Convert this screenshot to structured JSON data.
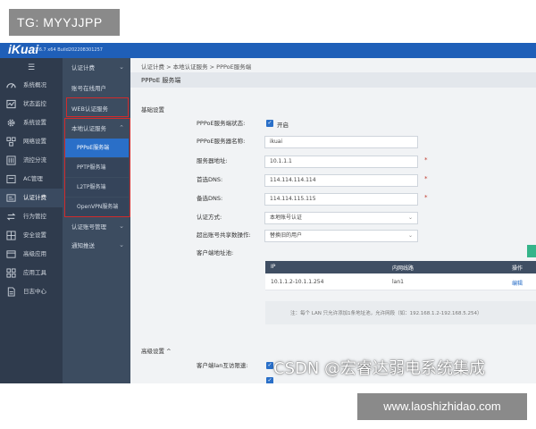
{
  "overlay": {
    "tag": "TG: MYYJJPP",
    "watermark": "CSDN @宏睿达弱电系统集成",
    "site": "www.laoshizhidao.com"
  },
  "header": {
    "logo": "iKuai",
    "version": "3.6.7 x64 Build202208301257"
  },
  "sidebar_primary": {
    "toggle": "☰",
    "items": [
      {
        "label": "系统概况",
        "icon": "dashboard-icon"
      },
      {
        "label": "状态监控",
        "icon": "monitor-icon"
      },
      {
        "label": "系统设置",
        "icon": "gear-icon"
      },
      {
        "label": "网络设置",
        "icon": "network-icon"
      },
      {
        "label": "流控分流",
        "icon": "flow-icon"
      },
      {
        "label": "AC管理",
        "icon": "ac-icon"
      },
      {
        "label": "认证计费",
        "icon": "auth-icon"
      },
      {
        "label": "行为管控",
        "icon": "behavior-icon"
      },
      {
        "label": "安全设置",
        "icon": "security-icon"
      },
      {
        "label": "高级应用",
        "icon": "advanced-icon"
      },
      {
        "label": "应用工具",
        "icon": "tools-icon"
      },
      {
        "label": "日志中心",
        "icon": "log-icon"
      }
    ]
  },
  "sidebar_secondary": {
    "group_title": "认证计费",
    "online_users": "账号在线用户",
    "web_auth": "WEB认证服务",
    "local_auth": "本地认证服务",
    "sub_items": [
      "PPPoE服务端",
      "PPTP服务端",
      "L2TP服务端",
      "OpenVPN服务端"
    ],
    "account_mgmt": "认证账号管理",
    "notify": "通知推送"
  },
  "content": {
    "breadcrumb": "认证计费 > 本地认证服务 > PPPoE服务端",
    "page_title": "PPPoE 服务端",
    "basic_section": "基础设置",
    "form": {
      "status_label": "PPPoE服务端状态:",
      "status_value": "开启",
      "name_label": "PPPoE服务器名称:",
      "name_value": "ikuai",
      "server_addr_label": "服务器地址:",
      "server_addr_value": "10.1.1.1",
      "dns1_label": "首选DNS:",
      "dns1_value": "114.114.114.114",
      "dns2_label": "备选DNS:",
      "dns2_value": "114.114.115.115",
      "auth_label": "认证方式:",
      "auth_value": "本地账号认证",
      "share_label": "超出账号共享数操作:",
      "share_value": "替换旧的用户",
      "pool_label": "客户端地址池:"
    },
    "table": {
      "headers": [
        "IP",
        "内网线路",
        "操作"
      ],
      "rows": [
        {
          "ip": "10.1.1.2-10.1.1.254",
          "line": "lan1",
          "action": "编辑"
        }
      ]
    },
    "hint": "注：每个 LAN 只允许添加1条地址池，允许网段（如：192.168.1.2-192.168.5.254）",
    "advanced_section": "高级设置",
    "advanced_row_label": "客户端lan互访限速:"
  },
  "colors": {
    "topbar": "#1f5fb8",
    "sidebar": "#2f3b4d",
    "accent": "#2a6fc8",
    "highlight": "#d12b2b"
  }
}
